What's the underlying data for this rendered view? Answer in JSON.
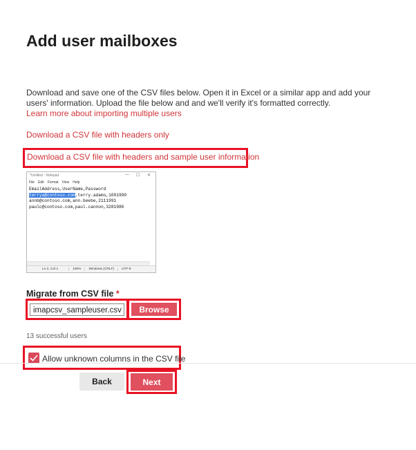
{
  "page": {
    "title": "Add user mailboxes",
    "description": "Download and save one of the CSV files below. Open it in Excel or a similar app and add your users' information. Upload the file below and and we'll verify it's formatted correctly.",
    "learn_more": "Learn more about importing multiple users",
    "download_headers_only": "Download a CSV file with headers only",
    "download_headers_sample": "Download a CSV file with headers and sample user information"
  },
  "notepad": {
    "title": "*Untitled - Notepad",
    "controls": {
      "minimize": "—",
      "maximize": "☐",
      "close": "✕"
    },
    "menu": [
      "File",
      "Edit",
      "Format",
      "View",
      "Help"
    ],
    "lines": {
      "l1": "EmailAddress,UserName,Password",
      "l2_sel": "terrya@contoso.com",
      "l2_rest": ",terry.adams,1091990",
      "l3": "annb@contoso.com,ann.beebe,2111991",
      "l4": "paulc@contoso.com,paul.cannon,3281986"
    },
    "status": [
      "Ln 2, Col 1",
      "100%",
      "Windows (CRLF)",
      "UTF-8"
    ]
  },
  "form": {
    "label": "Migrate from CSV file",
    "required_mark": "*",
    "file_value": "imapcsv_sampleuser.csv",
    "browse_label": "Browse",
    "success_text": "13 successful users",
    "checkbox_label": "Allow unknown columns in the CSV file",
    "checkbox_checked": true
  },
  "footer": {
    "back_label": "Back",
    "next_label": "Next"
  },
  "colors": {
    "accent": "#e0505e",
    "link": "#d13438",
    "highlight_border": "#e81123"
  }
}
